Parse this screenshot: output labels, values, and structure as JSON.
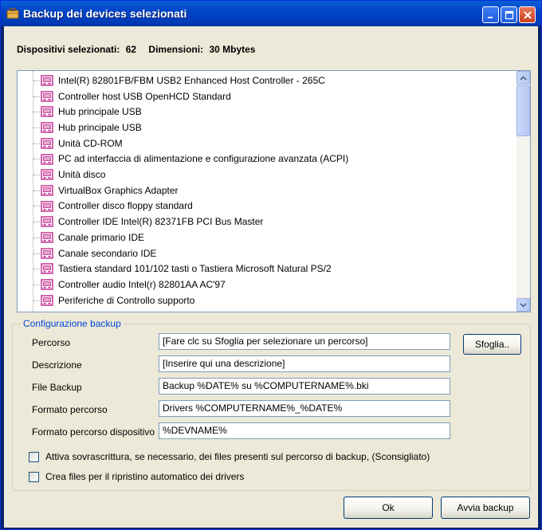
{
  "window": {
    "title": "Backup dei devices selezionati"
  },
  "summary": {
    "devices_label": "Dispositivi selezionati:",
    "devices_value": "62",
    "size_label": "Dimensioni:",
    "size_value": "30 Mbytes"
  },
  "devices": [
    "Intel(R) 82801FB/FBM USB2 Enhanced Host Controller - 265C",
    "Controller host USB OpenHCD Standard",
    "Hub principale USB",
    "Hub principale USB",
    "Unità CD-ROM",
    "PC ad interfaccia di alimentazione e configurazione avanzata (ACPI)",
    "Unità disco",
    "VirtualBox Graphics Adapter",
    "Controller disco floppy standard",
    "Controller IDE Intel(R) 82371FB PCI Bus Master",
    "Canale primario IDE",
    "Canale secondario IDE",
    "Tastiera standard 101/102 tasti o Tastiera Microsoft Natural PS/2",
    "Controller audio Intel(r) 82801AA AC'97",
    "Periferiche di Controllo supporto"
  ],
  "config": {
    "legend": "Configurazione backup",
    "fields": [
      {
        "label": "Percorso",
        "value": "[Fare clc su Sfoglia per selezionare un percorso]"
      },
      {
        "label": "Descrizione",
        "value": "[Inserire qui una descrizione]"
      },
      {
        "label": "File Backup",
        "value": "Backup %DATE% su %COMPUTERNAME%.bki"
      },
      {
        "label": "Formato percorso",
        "value": "Drivers %COMPUTERNAME%_%DATE%"
      },
      {
        "label": "Formato percorso dispositivo",
        "value": "%DEVNAME%"
      }
    ],
    "browse_label": "Sfoglia..",
    "checkboxes": [
      {
        "label": "Attiva sovrascrittura, se necessario, dei files presenti sul percorso di backup, (Sconsigliato)",
        "checked": false
      },
      {
        "label": "Crea files per il ripristino automatico dei drivers",
        "checked": false
      }
    ]
  },
  "buttons": {
    "ok": "Ok",
    "start_backup": "Avvia backup"
  },
  "colors": {
    "titlebar": "#0054e3",
    "dialog_bg": "#ece9d8",
    "legend_text": "#0046d5",
    "device_icon": "#c0288c"
  },
  "icons": {
    "app": "briefcase-icon",
    "device": "device-icon",
    "minimize": "minimize-icon",
    "maximize": "maximize-icon",
    "close": "close-icon"
  }
}
